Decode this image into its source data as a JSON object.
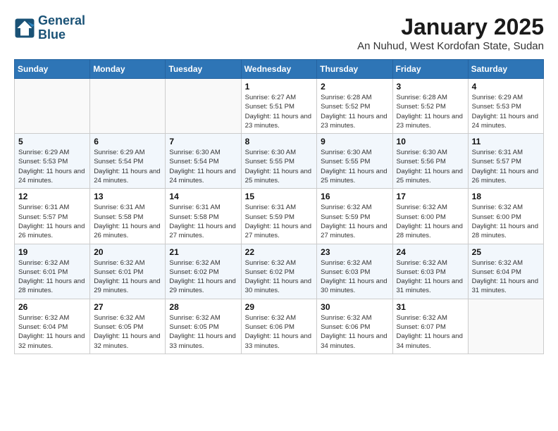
{
  "logo": {
    "line1": "General",
    "line2": "Blue"
  },
  "title": "January 2025",
  "subtitle": "An Nuhud, West Kordofan State, Sudan",
  "days_of_week": [
    "Sunday",
    "Monday",
    "Tuesday",
    "Wednesday",
    "Thursday",
    "Friday",
    "Saturday"
  ],
  "weeks": [
    [
      {
        "day": "",
        "info": ""
      },
      {
        "day": "",
        "info": ""
      },
      {
        "day": "",
        "info": ""
      },
      {
        "day": "1",
        "info": "Sunrise: 6:27 AM\nSunset: 5:51 PM\nDaylight: 11 hours and 23 minutes."
      },
      {
        "day": "2",
        "info": "Sunrise: 6:28 AM\nSunset: 5:52 PM\nDaylight: 11 hours and 23 minutes."
      },
      {
        "day": "3",
        "info": "Sunrise: 6:28 AM\nSunset: 5:52 PM\nDaylight: 11 hours and 23 minutes."
      },
      {
        "day": "4",
        "info": "Sunrise: 6:29 AM\nSunset: 5:53 PM\nDaylight: 11 hours and 24 minutes."
      }
    ],
    [
      {
        "day": "5",
        "info": "Sunrise: 6:29 AM\nSunset: 5:53 PM\nDaylight: 11 hours and 24 minutes."
      },
      {
        "day": "6",
        "info": "Sunrise: 6:29 AM\nSunset: 5:54 PM\nDaylight: 11 hours and 24 minutes."
      },
      {
        "day": "7",
        "info": "Sunrise: 6:30 AM\nSunset: 5:54 PM\nDaylight: 11 hours and 24 minutes."
      },
      {
        "day": "8",
        "info": "Sunrise: 6:30 AM\nSunset: 5:55 PM\nDaylight: 11 hours and 25 minutes."
      },
      {
        "day": "9",
        "info": "Sunrise: 6:30 AM\nSunset: 5:55 PM\nDaylight: 11 hours and 25 minutes."
      },
      {
        "day": "10",
        "info": "Sunrise: 6:30 AM\nSunset: 5:56 PM\nDaylight: 11 hours and 25 minutes."
      },
      {
        "day": "11",
        "info": "Sunrise: 6:31 AM\nSunset: 5:57 PM\nDaylight: 11 hours and 26 minutes."
      }
    ],
    [
      {
        "day": "12",
        "info": "Sunrise: 6:31 AM\nSunset: 5:57 PM\nDaylight: 11 hours and 26 minutes."
      },
      {
        "day": "13",
        "info": "Sunrise: 6:31 AM\nSunset: 5:58 PM\nDaylight: 11 hours and 26 minutes."
      },
      {
        "day": "14",
        "info": "Sunrise: 6:31 AM\nSunset: 5:58 PM\nDaylight: 11 hours and 27 minutes."
      },
      {
        "day": "15",
        "info": "Sunrise: 6:31 AM\nSunset: 5:59 PM\nDaylight: 11 hours and 27 minutes."
      },
      {
        "day": "16",
        "info": "Sunrise: 6:32 AM\nSunset: 5:59 PM\nDaylight: 11 hours and 27 minutes."
      },
      {
        "day": "17",
        "info": "Sunrise: 6:32 AM\nSunset: 6:00 PM\nDaylight: 11 hours and 28 minutes."
      },
      {
        "day": "18",
        "info": "Sunrise: 6:32 AM\nSunset: 6:00 PM\nDaylight: 11 hours and 28 minutes."
      }
    ],
    [
      {
        "day": "19",
        "info": "Sunrise: 6:32 AM\nSunset: 6:01 PM\nDaylight: 11 hours and 28 minutes."
      },
      {
        "day": "20",
        "info": "Sunrise: 6:32 AM\nSunset: 6:01 PM\nDaylight: 11 hours and 29 minutes."
      },
      {
        "day": "21",
        "info": "Sunrise: 6:32 AM\nSunset: 6:02 PM\nDaylight: 11 hours and 29 minutes."
      },
      {
        "day": "22",
        "info": "Sunrise: 6:32 AM\nSunset: 6:02 PM\nDaylight: 11 hours and 30 minutes."
      },
      {
        "day": "23",
        "info": "Sunrise: 6:32 AM\nSunset: 6:03 PM\nDaylight: 11 hours and 30 minutes."
      },
      {
        "day": "24",
        "info": "Sunrise: 6:32 AM\nSunset: 6:03 PM\nDaylight: 11 hours and 31 minutes."
      },
      {
        "day": "25",
        "info": "Sunrise: 6:32 AM\nSunset: 6:04 PM\nDaylight: 11 hours and 31 minutes."
      }
    ],
    [
      {
        "day": "26",
        "info": "Sunrise: 6:32 AM\nSunset: 6:04 PM\nDaylight: 11 hours and 32 minutes."
      },
      {
        "day": "27",
        "info": "Sunrise: 6:32 AM\nSunset: 6:05 PM\nDaylight: 11 hours and 32 minutes."
      },
      {
        "day": "28",
        "info": "Sunrise: 6:32 AM\nSunset: 6:05 PM\nDaylight: 11 hours and 33 minutes."
      },
      {
        "day": "29",
        "info": "Sunrise: 6:32 AM\nSunset: 6:06 PM\nDaylight: 11 hours and 33 minutes."
      },
      {
        "day": "30",
        "info": "Sunrise: 6:32 AM\nSunset: 6:06 PM\nDaylight: 11 hours and 34 minutes."
      },
      {
        "day": "31",
        "info": "Sunrise: 6:32 AM\nSunset: 6:07 PM\nDaylight: 11 hours and 34 minutes."
      },
      {
        "day": "",
        "info": ""
      }
    ]
  ]
}
